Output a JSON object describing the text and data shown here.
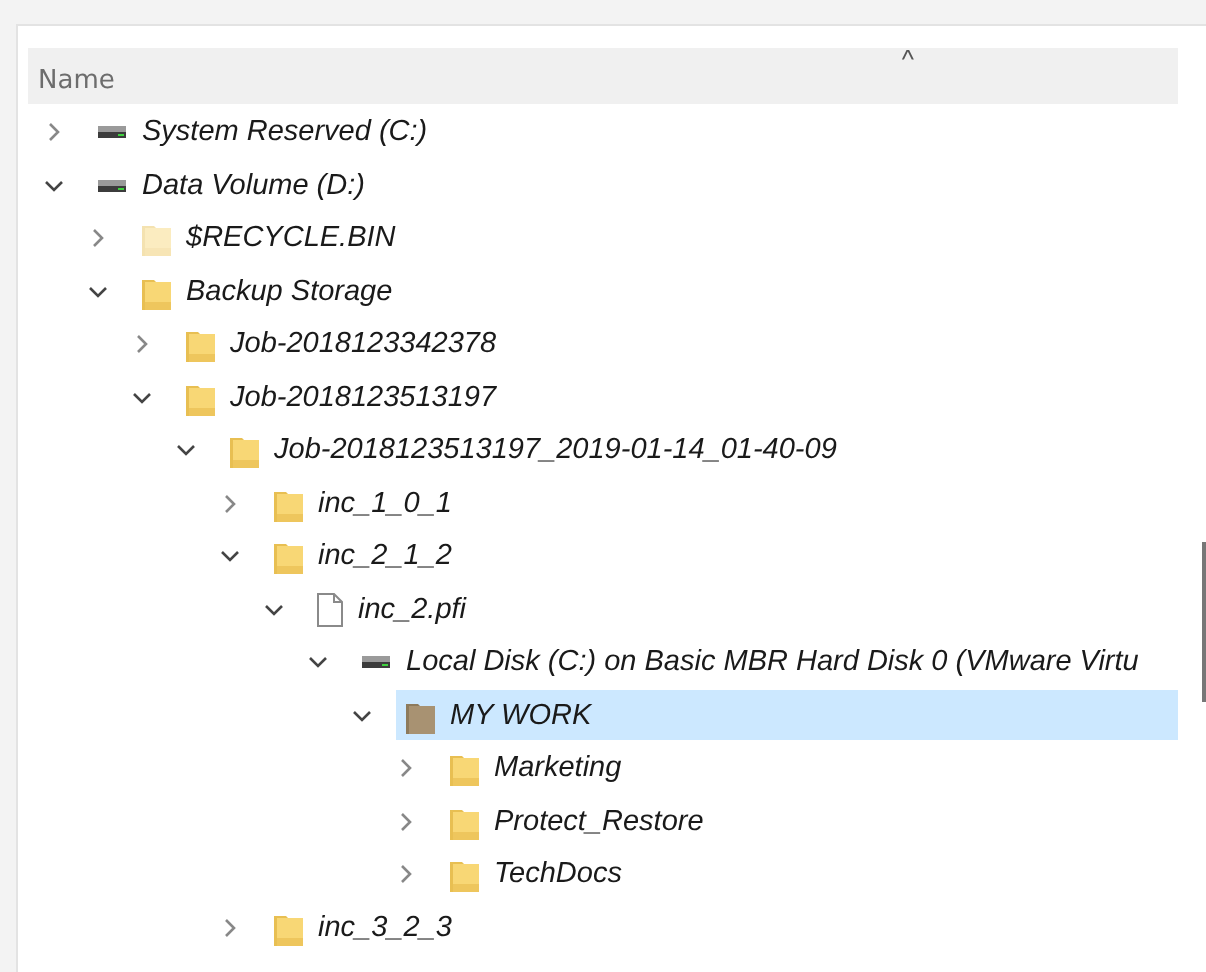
{
  "header": {
    "column": "Name",
    "sort_indicator": "^"
  },
  "tree": [
    {
      "label": "System Reserved (C:)",
      "kind": "drive",
      "expanded": false,
      "selected": false,
      "hidden": false
    },
    {
      "label": "Data Volume (D:)",
      "kind": "drive",
      "expanded": true,
      "selected": false,
      "hidden": false,
      "children": [
        {
          "label": "$RECYCLE.BIN",
          "kind": "folder",
          "expanded": false,
          "selected": false,
          "hidden": true
        },
        {
          "label": "Backup Storage",
          "kind": "folder",
          "expanded": true,
          "selected": false,
          "hidden": false,
          "children": [
            {
              "label": "Job-2018123342378",
              "kind": "folder",
              "expanded": false,
              "selected": false,
              "hidden": false
            },
            {
              "label": "Job-2018123513197",
              "kind": "folder",
              "expanded": true,
              "selected": false,
              "hidden": false,
              "children": [
                {
                  "label": "Job-2018123513197_2019-01-14_01-40-09",
                  "kind": "folder",
                  "expanded": true,
                  "selected": false,
                  "hidden": false,
                  "children": [
                    {
                      "label": "inc_1_0_1",
                      "kind": "folder",
                      "expanded": false,
                      "selected": false,
                      "hidden": false
                    },
                    {
                      "label": "inc_2_1_2",
                      "kind": "folder",
                      "expanded": true,
                      "selected": false,
                      "hidden": false,
                      "children": [
                        {
                          "label": "inc_2.pfi",
                          "kind": "file",
                          "expanded": true,
                          "selected": false,
                          "hidden": false,
                          "children": [
                            {
                              "label": "Local Disk (C:) on Basic MBR Hard Disk 0 (VMware Virtu",
                              "kind": "drive",
                              "expanded": true,
                              "selected": false,
                              "hidden": false,
                              "children": [
                                {
                                  "label": "MY WORK",
                                  "kind": "special",
                                  "expanded": true,
                                  "selected": true,
                                  "hidden": false,
                                  "children": [
                                    {
                                      "label": "Marketing",
                                      "kind": "folder",
                                      "expanded": false,
                                      "selected": false,
                                      "hidden": false
                                    },
                                    {
                                      "label": "Protect_Restore",
                                      "kind": "folder",
                                      "expanded": false,
                                      "selected": false,
                                      "hidden": false
                                    },
                                    {
                                      "label": "TechDocs",
                                      "kind": "folder",
                                      "expanded": false,
                                      "selected": false,
                                      "hidden": false
                                    }
                                  ]
                                }
                              ]
                            }
                          ]
                        }
                      ]
                    },
                    {
                      "label": "inc_3_2_3",
                      "kind": "folder",
                      "expanded": false,
                      "selected": false,
                      "hidden": false
                    }
                  ]
                }
              ]
            }
          ]
        }
      ]
    }
  ]
}
